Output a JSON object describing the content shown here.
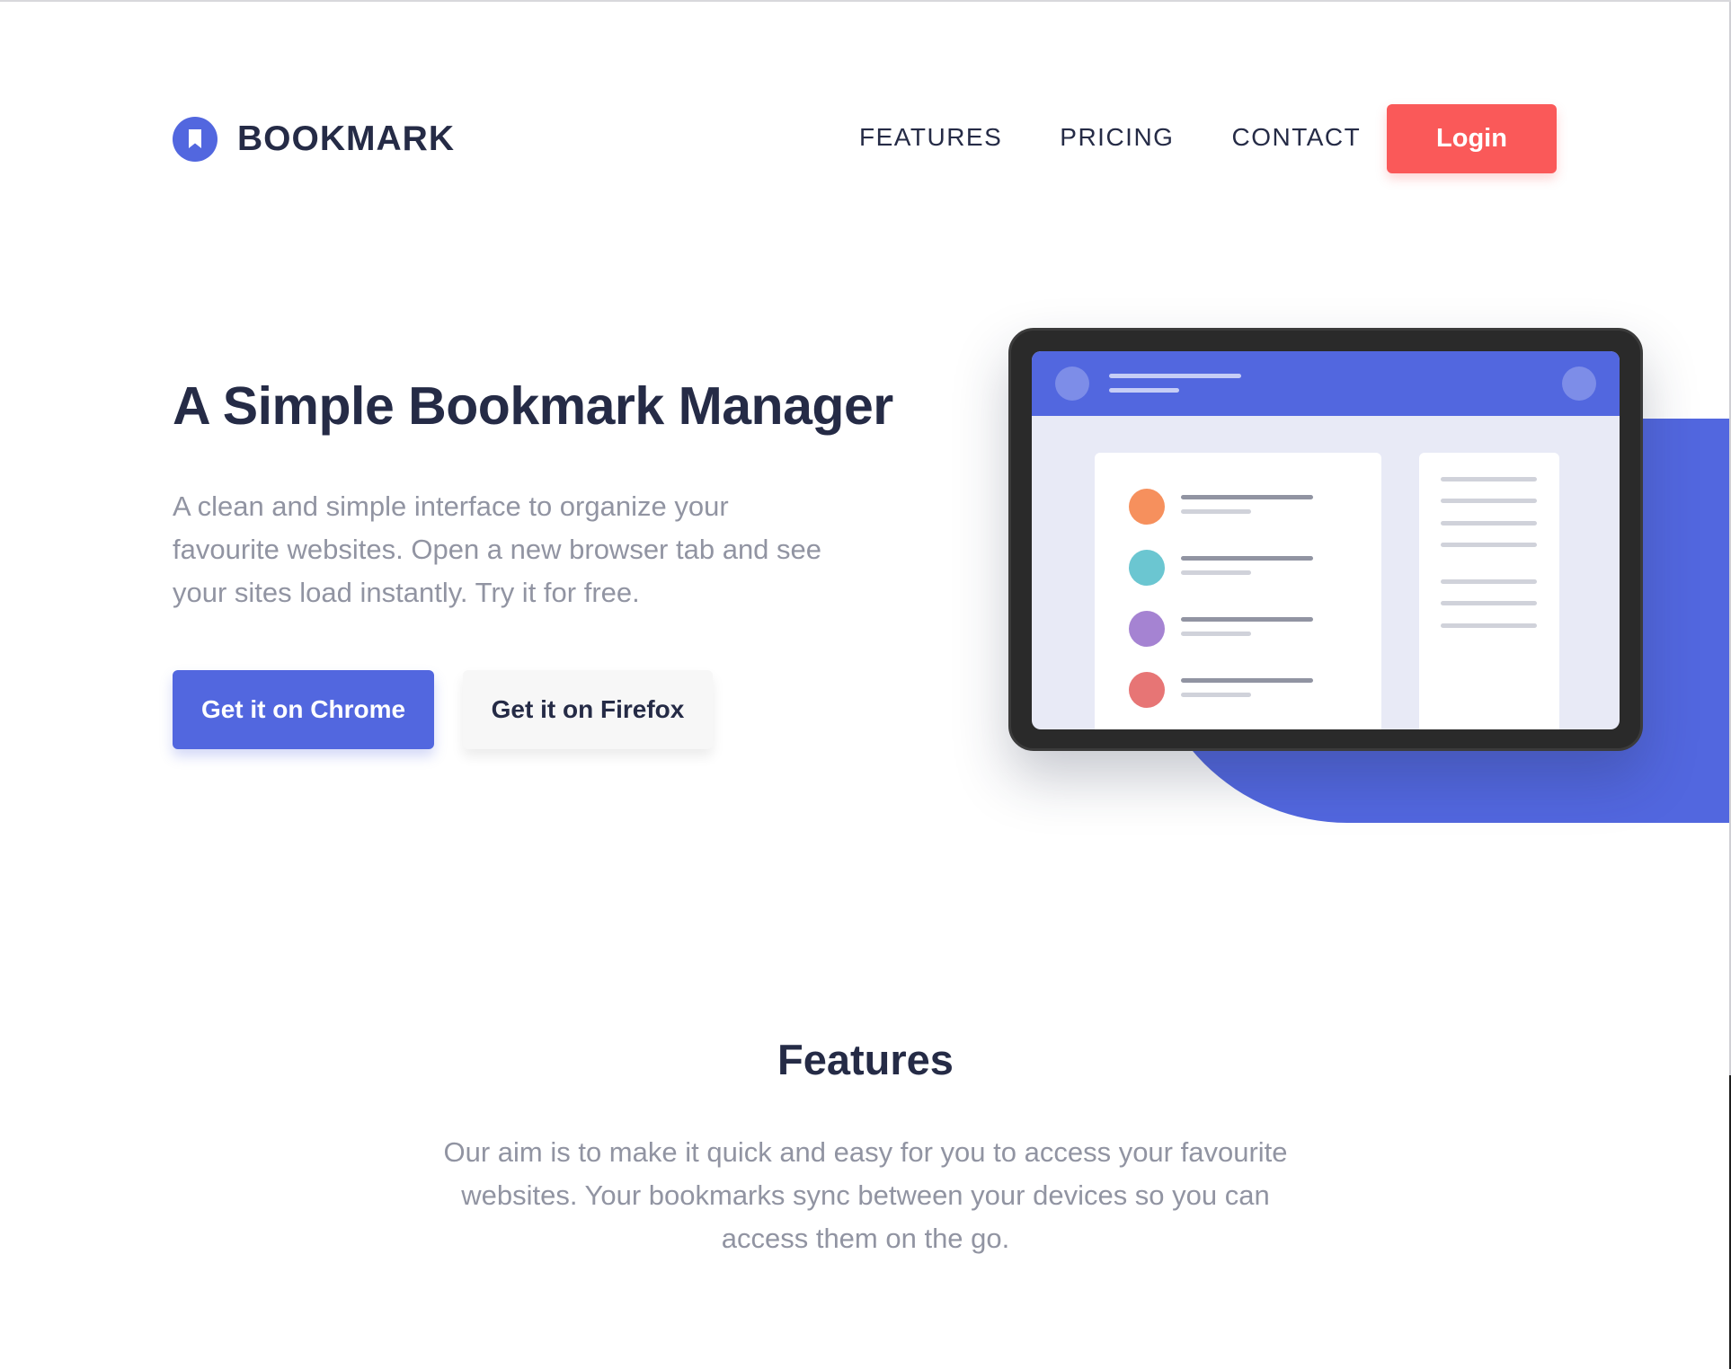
{
  "brand": {
    "name": "BOOKMARK",
    "icon": "bookmark-icon",
    "color": "#5267DF"
  },
  "nav": {
    "items": [
      "FEATURES",
      "PRICING",
      "CONTACT"
    ],
    "login_label": "Login"
  },
  "hero": {
    "title": "A Simple Bookmark Manager",
    "description": "A clean and simple interface to organize your favourite websites. Open a new browser tab and see your sites load instantly. Try it for free.",
    "chrome_button": "Get it on Chrome",
    "firefox_button": "Get it on Firefox"
  },
  "illustration": {
    "item_colors": [
      "#F6905D",
      "#6BC6D1",
      "#A583D2",
      "#E77575"
    ]
  },
  "features": {
    "title": "Features",
    "description": "Our aim is to make it quick and easy for you to access your favourite websites. Your bookmarks sync between your devices so you can access them on the go."
  },
  "colors": {
    "primary": "#5267DF",
    "accent_red": "#FA5959",
    "dark_text": "#252B46",
    "muted_text": "#9194A2"
  }
}
